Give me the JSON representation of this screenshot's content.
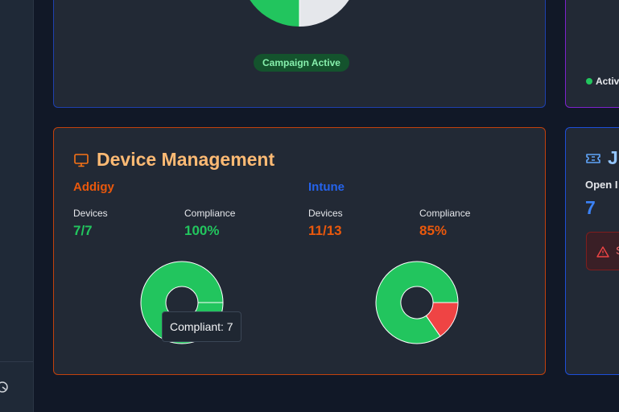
{
  "campaign": {
    "badge": "Campaign Active",
    "pie_fraction": 0.5,
    "colors": {
      "filled": "#22c55e",
      "empty": "#e5e7eb"
    }
  },
  "purple_card": {
    "status": "Active"
  },
  "device_management": {
    "title": "Device Management",
    "icon": "monitor-icon",
    "providers": [
      {
        "name": "Addigy",
        "color": "#ea580c",
        "devices_label": "Devices",
        "devices_value": "7/7",
        "compliance_label": "Compliance",
        "compliance_value": "100%",
        "value_color": "#22c55e",
        "compliant": 7,
        "non_compliant": 0
      },
      {
        "name": "Intune",
        "color": "#2563eb",
        "devices_label": "Devices",
        "devices_value": "11/13",
        "compliance_label": "Compliance",
        "compliance_value": "85%",
        "value_color": "#ea580c",
        "compliant": 11,
        "non_compliant": 2
      }
    ],
    "tooltip": "Compliant: 7",
    "colors": {
      "compliant": "#22c55e",
      "non_compliant": "#ef4444"
    }
  },
  "jira": {
    "title": "Ji",
    "icon": "ticket-icon",
    "open_label": "Open I",
    "open_value": "7",
    "alert_text": "S",
    "alert_icon": "warning-icon"
  },
  "sidebar": {
    "bottom_icon": "bot-icon"
  }
}
